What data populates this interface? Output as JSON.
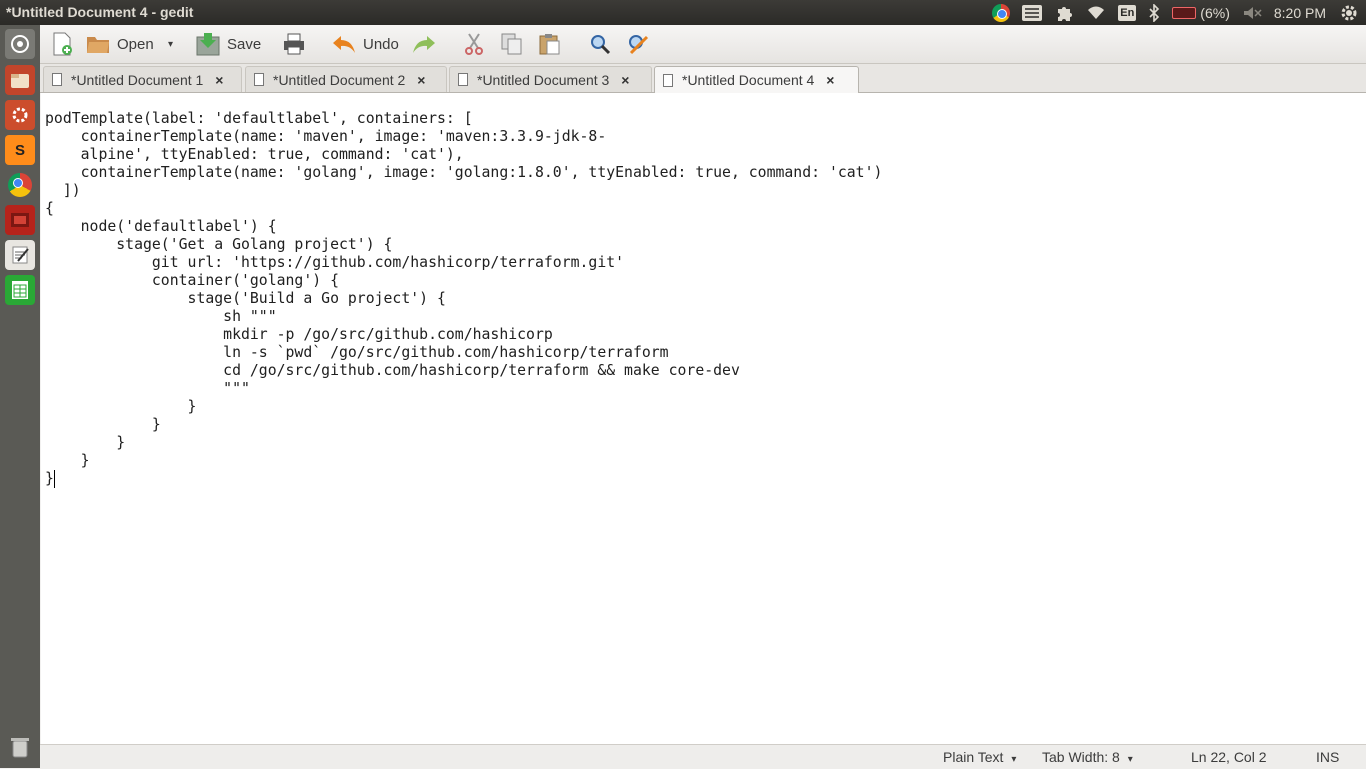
{
  "window": {
    "title": "*Untitled Document 4 - gedit"
  },
  "indicators": {
    "keyboard": "En",
    "battery": "(6%)",
    "clock": "8:20 PM",
    "icons": [
      "chrome-icon",
      "list-icon",
      "puzzle-icon",
      "wifi-icon",
      "keyboard-icon",
      "bluetooth-icon",
      "battery-icon",
      "volume-muted-icon",
      "settings-gear-icon"
    ]
  },
  "launcher": {
    "items": [
      "ubuntu-dash-icon",
      "file-manager-icon",
      "system-tools-icon",
      "sublime-text-icon",
      "chrome-icon",
      "slides-icon",
      "text-editor-icon",
      "spreadsheet-icon",
      "trash-icon"
    ]
  },
  "toolbar": {
    "open_label": "Open",
    "save_label": "Save",
    "undo_label": "Undo"
  },
  "tabs": [
    {
      "label": "*Untitled Document 1",
      "active": false
    },
    {
      "label": "*Untitled Document 2",
      "active": false
    },
    {
      "label": "*Untitled Document 3",
      "active": false
    },
    {
      "label": "*Untitled Document 4",
      "active": true
    }
  ],
  "editor": {
    "content": "podTemplate(label: 'defaultlabel', containers: [\n    containerTemplate(name: 'maven', image: 'maven:3.3.9-jdk-8-\n    alpine', ttyEnabled: true, command: 'cat'),\n    containerTemplate(name: 'golang', image: 'golang:1.8.0', ttyEnabled: true, command: 'cat')\n  ])\n{\n    node('defaultlabel') {\n        stage('Get a Golang project') {\n            git url: 'https://github.com/hashicorp/terraform.git'\n            container('golang') {\n                stage('Build a Go project') {\n                    sh \"\"\"\n                    mkdir -p /go/src/github.com/hashicorp\n                    ln -s `pwd` /go/src/github.com/hashicorp/terraform\n                    cd /go/src/github.com/hashicorp/terraform && make core-dev\n                    \"\"\"\n                }\n            }\n        }\n    }\n}"
  },
  "statusbar": {
    "language": "Plain Text",
    "tab_width": "Tab Width: 8",
    "position": "Ln 22, Col 2",
    "mode": "INS"
  }
}
